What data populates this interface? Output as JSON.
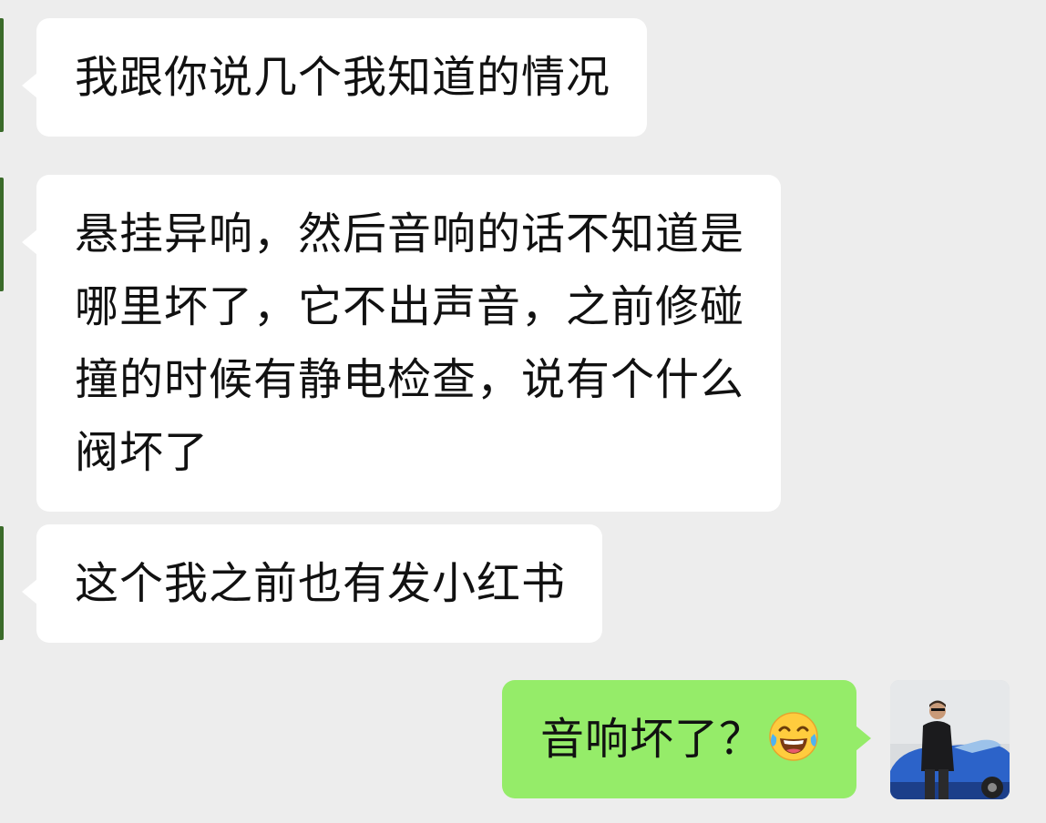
{
  "chat": {
    "messages": [
      {
        "side": "incoming",
        "text": "我跟你说几个我知道的情况"
      },
      {
        "side": "incoming",
        "lines": [
          "悬挂异响，然后音响的话不知道是",
          "哪里坏了，它不出声音，之前修碰",
          "撞的时候有静电检查，说有个什么",
          "阀坏了"
        ]
      },
      {
        "side": "incoming",
        "text": "这个我之前也有发小红书"
      },
      {
        "side": "outgoing",
        "text": "音响坏了？",
        "emoji": "tears-of-joy-emoji-icon"
      }
    ]
  },
  "colors": {
    "background": "#ededed",
    "incoming_bubble": "#ffffff",
    "outgoing_bubble": "#95ec69",
    "contact_avatar_edge": "#3b6b2a"
  }
}
